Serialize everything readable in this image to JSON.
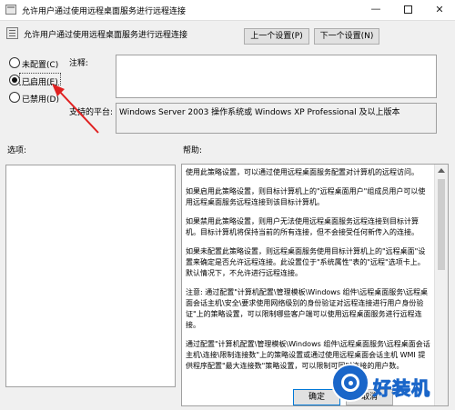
{
  "window": {
    "title": "允许用户通过使用远程桌面服务进行远程连接",
    "min_glyph": "—",
    "close_glyph": "✕"
  },
  "header": {
    "policy_name": "允许用户通过使用远程桌面服务进行远程连接",
    "prev_button": "上一个设置(P)",
    "next_button": "下一个设置(N)"
  },
  "state_options": {
    "not_configured": "未配置(C)",
    "enabled": "已启用(E)",
    "disabled": "已禁用(D)",
    "selected": "enabled"
  },
  "labels": {
    "comment": "注释:",
    "supported_on": "支持的平台:",
    "options": "选项:",
    "help": "帮助:"
  },
  "comment_value": "",
  "supported_on_value": "Windows Server 2003 操作系统或 Windows XP Professional 及以上版本",
  "help_paragraphs": [
    "使用此策略设置，可以通过使用远程桌面服务配置对计算机的远程访问。",
    "如果启用此策略设置，则目标计算机上的\"远程桌面用户\"组成员用户可以使用远程桌面服务远程连接到该目标计算机。",
    "如果禁用此策略设置，则用户无法使用远程桌面服务远程连接到目标计算机。目标计算机将保持当前的所有连接，但不会接受任何新传入的连接。",
    "如果未配置此策略设置，则远程桌面服务使用目标计算机上的\"远程桌面\"设置来确定是否允许远程连接。此设置位于\"系统属性\"表的\"远程\"选项卡上。默认情况下，不允许进行远程连接。",
    "注意: 通过配置\"计算机配置\\管理模板\\Windows 组件\\远程桌面服务\\远程桌面会话主机\\安全\\要求使用网络级别的身份验证对远程连接进行用户身份验证\"上的策略设置，可以限制哪些客户端可以使用远程桌面服务进行远程连接。",
    "通过配置\"计算机配置\\管理模板\\Windows 组件\\远程桌面服务\\远程桌面会话主机\\连接\\限制连接数\"上的策略设置或通过使用远程桌面会话主机 WMI 提供程序配置\"最大连接数\"策略设置，可以限制可同时连接的用户数。"
  ],
  "footer": {
    "ok_button": "确定",
    "cancel_button": "取消"
  },
  "watermark": {
    "text": "好装机"
  },
  "annotation": {
    "color": "#e02020"
  }
}
